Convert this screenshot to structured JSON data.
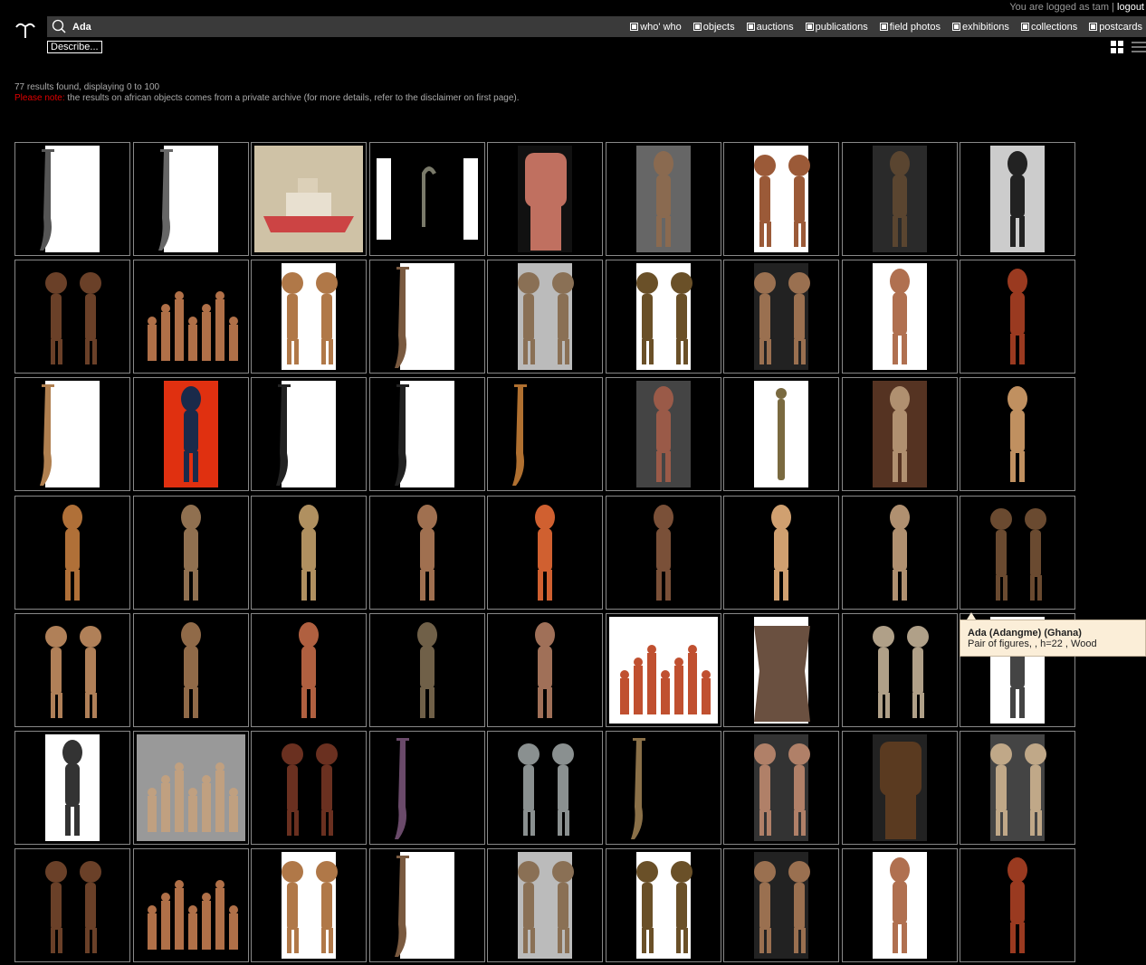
{
  "header": {
    "logged_prefix": "You are logged as tam",
    "logout_label": "logout",
    "search_value": "Ada",
    "filters": [
      {
        "label": "who' who"
      },
      {
        "label": "objects"
      },
      {
        "label": "auctions"
      },
      {
        "label": "publications"
      },
      {
        "label": "field photos"
      },
      {
        "label": "exhibitions"
      },
      {
        "label": "collections"
      },
      {
        "label": "postcards"
      }
    ],
    "describe_label": "Describe..."
  },
  "results": {
    "count_text": "77 results found, displaying 0 to 100",
    "note_label": "Please note:",
    "note_text": " the results on african objects comes from a private archive (for more details, refer to the disclaimer on first page)."
  },
  "tooltip": {
    "title": "Ada (Adangme) (Ghana)",
    "detail": "Pair of figures, , h=22 , Wood"
  },
  "colors": {
    "background": "#000000",
    "searchbar": "#3a3a3a",
    "warning": "#e00000",
    "tooltip_bg": "#fbeed8"
  },
  "thumbnails": [
    {
      "bg": "#ffffff",
      "type": "sword",
      "fg": "#555"
    },
    {
      "bg": "#ffffff",
      "type": "sword",
      "fg": "#666"
    },
    {
      "bg": "#cfc2a6",
      "type": "boat",
      "fg": "#c44"
    },
    {
      "bg": "#000000",
      "type": "hook",
      "fg": "#7a7a6a"
    },
    {
      "bg": "#111111",
      "type": "head",
      "fg": "#c07060"
    },
    {
      "bg": "#666666",
      "type": "figure",
      "fg": "#8a6a50"
    },
    {
      "bg": "#ffffff",
      "type": "pair",
      "fg": "#9b5a38"
    },
    {
      "bg": "#2a2a2a",
      "type": "figure",
      "fg": "#5a4530"
    },
    {
      "bg": "#cccccc",
      "type": "figure",
      "fg": "#222222"
    },
    {
      "bg": "#000000",
      "type": "pair",
      "fg": "#6a4028"
    },
    {
      "bg": "#000000",
      "type": "group",
      "fg": "#b07048"
    },
    {
      "bg": "#ffffff",
      "type": "pair",
      "fg": "#b07848"
    },
    {
      "bg": "#ffffff",
      "type": "sword",
      "fg": "#7a5a40"
    },
    {
      "bg": "#bbbbbb",
      "type": "pair",
      "fg": "#8a7055"
    },
    {
      "bg": "#ffffff",
      "type": "pair",
      "fg": "#6a5028"
    },
    {
      "bg": "#222222",
      "type": "pair",
      "fg": "#9a7050"
    },
    {
      "bg": "#ffffff",
      "type": "figure",
      "fg": "#b07050"
    },
    {
      "bg": "#000000",
      "type": "figure",
      "fg": "#9a3a20"
    },
    {
      "bg": "#ffffff",
      "type": "sword",
      "fg": "#b08050"
    },
    {
      "bg": "#e03010",
      "type": "figure",
      "fg": "#1a2a4a"
    },
    {
      "bg": "#ffffff",
      "type": "sword",
      "fg": "#222222"
    },
    {
      "bg": "#ffffff",
      "type": "sword",
      "fg": "#222222"
    },
    {
      "bg": "#000000",
      "type": "sword",
      "fg": "#b07030"
    },
    {
      "bg": "#444444",
      "type": "figure",
      "fg": "#9a5a48"
    },
    {
      "bg": "#ffffff",
      "type": "stick",
      "fg": "#7a6a40"
    },
    {
      "bg": "#553322",
      "type": "figure",
      "fg": "#b09070"
    },
    {
      "bg": "#000000",
      "type": "figure",
      "fg": "#c09060"
    },
    {
      "bg": "#000000",
      "type": "figure",
      "fg": "#b07038"
    },
    {
      "bg": "#000000",
      "type": "figure",
      "fg": "#907050"
    },
    {
      "bg": "#000000",
      "type": "figure",
      "fg": "#b09060"
    },
    {
      "bg": "#000000",
      "type": "figure",
      "fg": "#a07050"
    },
    {
      "bg": "#000000",
      "type": "figure",
      "fg": "#d06030"
    },
    {
      "bg": "#000000",
      "type": "figure",
      "fg": "#7a5038"
    },
    {
      "bg": "#000000",
      "type": "figure",
      "fg": "#d0a070"
    },
    {
      "bg": "#000000",
      "type": "figure",
      "fg": "#b09070"
    },
    {
      "bg": "#000000",
      "type": "pair",
      "fg": "#6a4a30"
    },
    {
      "bg": "#000000",
      "type": "pair",
      "fg": "#b08058"
    },
    {
      "bg": "#000000",
      "type": "figure",
      "fg": "#906a48"
    },
    {
      "bg": "#000000",
      "type": "figure",
      "fg": "#b06040"
    },
    {
      "bg": "#000000",
      "type": "figure",
      "fg": "#706048"
    },
    {
      "bg": "#000000",
      "type": "figure",
      "fg": "#a07058"
    },
    {
      "bg": "#ffffff",
      "type": "group",
      "fg": "#c05030"
    },
    {
      "bg": "#ffffff",
      "type": "stool",
      "fg": "#6a5040"
    },
    {
      "bg": "#000000",
      "type": "pair",
      "fg": "#b0a088"
    },
    {
      "bg": "#ffffff",
      "type": "figure",
      "fg": "#444444"
    },
    {
      "bg": "#ffffff",
      "type": "figure",
      "fg": "#333333"
    },
    {
      "bg": "#999999",
      "type": "group",
      "fg": "#c0a080"
    },
    {
      "bg": "#000000",
      "type": "pair",
      "fg": "#6a3020"
    },
    {
      "bg": "#000000",
      "type": "sword",
      "fg": "#6a4a6a"
    },
    {
      "bg": "#000000",
      "type": "pair",
      "fg": "#8a9090"
    },
    {
      "bg": "#000000",
      "type": "sword",
      "fg": "#8a7048"
    },
    {
      "bg": "#333333",
      "type": "pair",
      "fg": "#b08068"
    },
    {
      "bg": "#222222",
      "type": "head",
      "fg": "#5a3a20"
    },
    {
      "bg": "#444444",
      "type": "pair",
      "fg": "#c0a888"
    },
    {
      "bg": "#000000",
      "type": "pair",
      "fg": "#6a4028"
    },
    {
      "bg": "#000000",
      "type": "group",
      "fg": "#b07048"
    },
    {
      "bg": "#ffffff",
      "type": "pair",
      "fg": "#b07848"
    },
    {
      "bg": "#ffffff",
      "type": "sword",
      "fg": "#7a5a40"
    },
    {
      "bg": "#bbbbbb",
      "type": "pair",
      "fg": "#8a7055"
    },
    {
      "bg": "#ffffff",
      "type": "pair",
      "fg": "#6a5028"
    },
    {
      "bg": "#222222",
      "type": "pair",
      "fg": "#9a7050"
    },
    {
      "bg": "#ffffff",
      "type": "figure",
      "fg": "#b07050"
    },
    {
      "bg": "#000000",
      "type": "figure",
      "fg": "#9a3a20"
    }
  ]
}
